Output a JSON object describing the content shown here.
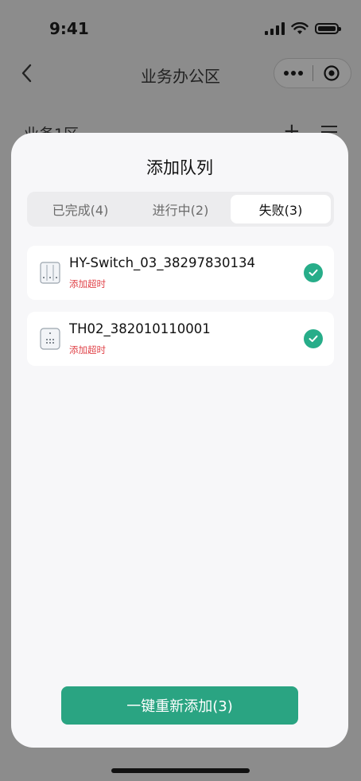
{
  "status_bar": {
    "time": "9:41"
  },
  "nav": {
    "title": "业务办公区"
  },
  "background": {
    "section_title": "业务1区",
    "add_symbol": "+"
  },
  "modal": {
    "title": "添加队列",
    "tabs": [
      {
        "label": "已完成(4)",
        "active": false
      },
      {
        "label": "进行中(2)",
        "active": false
      },
      {
        "label": "失败(3)",
        "active": true
      }
    ],
    "devices": [
      {
        "name": "HY-Switch_03_38297830134",
        "status": "添加超时",
        "icon": "switch-icon"
      },
      {
        "name": "TH02_382010110001",
        "status": "添加超时",
        "icon": "sensor-icon"
      }
    ],
    "retry_label": "一键重新添加(3)"
  },
  "colors": {
    "accent": "#2aa482",
    "error": "#e0444a",
    "check": "#27ad89"
  }
}
